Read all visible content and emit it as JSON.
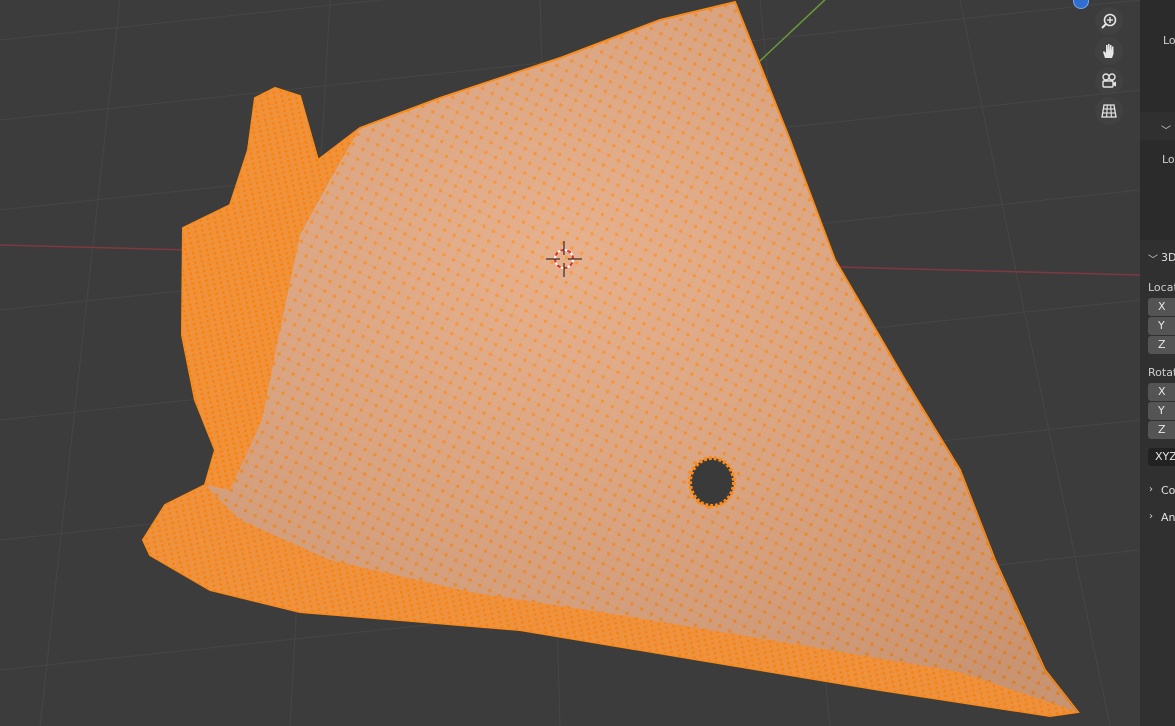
{
  "viewport": {
    "gizmo": {
      "buttons": [
        {
          "name": "zoom-icon"
        },
        {
          "name": "pan-hand-icon"
        },
        {
          "name": "camera-view-icon"
        },
        {
          "name": "ortho-grid-icon"
        }
      ]
    },
    "colors": {
      "background": "#3c3c3c",
      "mesh_face": "#e0a57e",
      "vertex": "#ff8c1a",
      "x_axis": "#8a3a44",
      "y_axis": "#6a9a3a"
    }
  },
  "side_panel": {
    "item_label_top": "Lo",
    "item_label_mid": "Loc",
    "section_3d": "3D",
    "location_label": "Locat",
    "location_fields": [
      "X",
      "Y",
      "Z"
    ],
    "rotation_label": "Rotat",
    "rotation_fields": [
      "X",
      "Y",
      "Z"
    ],
    "rotation_mode": "XYZ",
    "collapsed_sections": [
      "Co",
      "An"
    ]
  }
}
